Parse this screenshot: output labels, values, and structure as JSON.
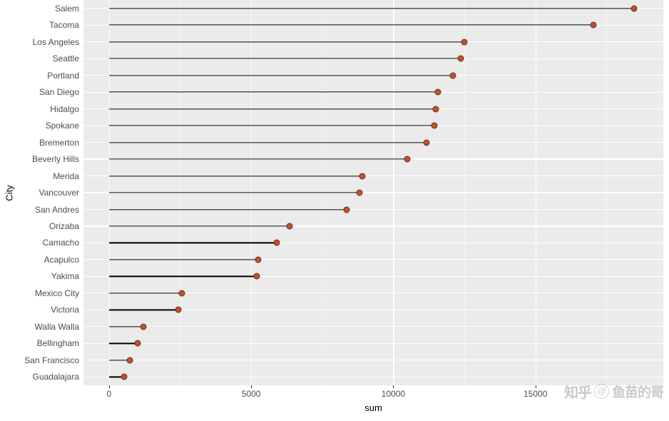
{
  "chart_data": {
    "type": "lollipop",
    "title": "",
    "xlabel": "sum",
    "ylabel": "City",
    "xlim": [
      -900,
      19500
    ],
    "x_ticks": [
      0,
      5000,
      10000,
      15000
    ],
    "x_tick_labels": [
      "0",
      "5000",
      "10000",
      "15000"
    ],
    "grid": true,
    "legend": "none",
    "point_color": "#c2512c",
    "point_outline_color": "#6b2a14",
    "segment_color": "#000000",
    "panel_background": "#ebebeb",
    "gridline_color": "#ffffff",
    "categories": [
      "Salem",
      "Tacoma",
      "Los Angeles",
      "Seattle",
      "Portland",
      "San Diego",
      "Hidalgo",
      "Spokane",
      "Bremerton",
      "Beverly Hills",
      "Merida",
      "Vancouver",
      "San Andres",
      "Orizaba",
      "Camacho",
      "Acapulco",
      "Yakima",
      "Mexico City",
      "Victoria",
      "Walla Walla",
      "Bellingham",
      "San Francisco",
      "Guadalajara"
    ],
    "values": [
      18480,
      17040,
      12500,
      12360,
      12100,
      11560,
      11500,
      11450,
      11160,
      10500,
      8900,
      8800,
      8350,
      6340,
      5910,
      5240,
      5190,
      2560,
      2430,
      1200,
      1000,
      730,
      530
    ]
  },
  "watermark": {
    "logo": "知乎",
    "at": "@",
    "user": "鱼苗的哥"
  }
}
